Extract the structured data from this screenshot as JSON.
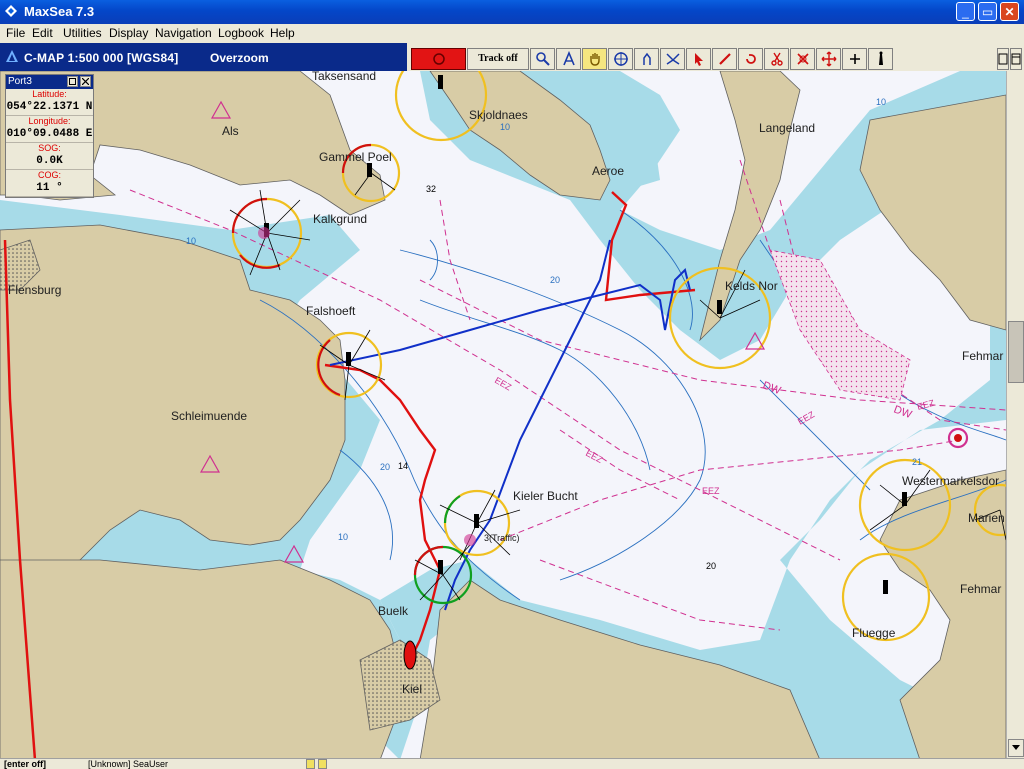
{
  "window": {
    "title": "MaxSea 7.3",
    "minimize": "_",
    "restore": "▭",
    "close": "✕"
  },
  "menu": [
    "File",
    "Edit",
    "Utilities",
    "Display",
    "Navigation",
    "Logbook",
    "Help"
  ],
  "chart_bar": {
    "title": "C-MAP  1:500 000 [WGS84]",
    "status": "Overzoom"
  },
  "toolbar": {
    "track_label": "Track off",
    "icons": [
      "zoom-icon",
      "compass-icon",
      "hand-pan-icon",
      "crosshair-icon",
      "route-icon",
      "waypoint-icon",
      "pointer-icon",
      "pencil-icon",
      "undo-icon",
      "scissors-icon",
      "mark-icon",
      "move-icon",
      "plus-icon",
      "lighthouse-icon"
    ]
  },
  "port_panel": {
    "title": "Port3",
    "fields": [
      {
        "label": "Latitude:",
        "value": "054°22.1371 N"
      },
      {
        "label": "Longitude:",
        "value": "010°09.0488 E"
      },
      {
        "label": "SOG:",
        "value": "0.0K"
      },
      {
        "label": "COG:",
        "value": "11 °"
      }
    ]
  },
  "map_labels": {
    "taksensand": "Taksensand",
    "als": "Als",
    "skjoldnaes": "Skjoldnaes",
    "langeland": "Langeland",
    "gammel_poel": "Gammel Poel",
    "aeroe": "Aeroe",
    "kalkgrund": "Kalkgrund",
    "flensburg": "Flensburg",
    "keldsnor": "Kelds Nor",
    "falshoeft": "Falshoeft",
    "fehmarn1": "Fehmar",
    "schleimuende": "Schleimuende",
    "kieler_bucht": "Kieler Bucht",
    "traffic": "3(Traffic)",
    "westermarkelsdorf": "Westermarkelsdor",
    "marienleuchte": "Marien",
    "buelk": "Buelk",
    "fehmarn2": "Fehmar",
    "fluegge": "Fluegge",
    "kiel": "Kiel",
    "eez1": "EEZ",
    "eez2": "EEZ",
    "eez3": "EEZ",
    "eez4": "EEZ",
    "eez5": "EEZ",
    "dw1": "DW",
    "dw2": "DW",
    "depth_32": "32",
    "depth_14": "14",
    "depth_20a": "20",
    "depth_20b": "20",
    "depth_20c": "20",
    "depth_10a": "10",
    "depth_10b": "10",
    "depth_10c": "10",
    "depth_10d": "10",
    "depth_21": "21"
  },
  "status": {
    "left": "[enter off]",
    "user": "[Unknown] SeaUser"
  },
  "colors": {
    "land": "#d8cca6",
    "shallow": "#a7dbe8",
    "deep": "#f4f5fb",
    "track_blue": "#1030c8",
    "track_red": "#e01010",
    "light_ring": "#f0c020",
    "boundary": "#d03090"
  }
}
